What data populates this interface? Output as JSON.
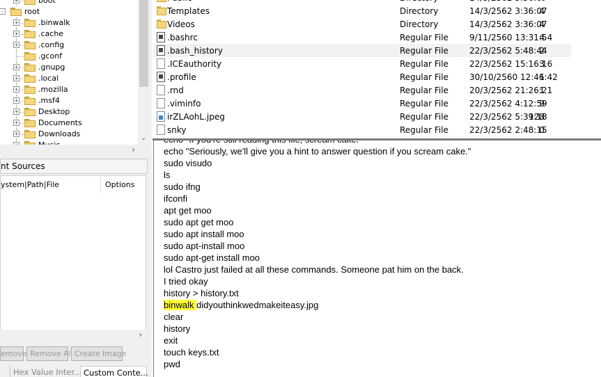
{
  "tree": {
    "items": [
      {
        "label": "boot",
        "indent": 1,
        "expander": "+"
      },
      {
        "label": "root",
        "indent": 0,
        "expander": "−"
      },
      {
        "label": ".binwalk",
        "indent": 1,
        "expander": "+"
      },
      {
        "label": ".cache",
        "indent": 1,
        "expander": "+"
      },
      {
        "label": ".config",
        "indent": 1,
        "expander": "+"
      },
      {
        "label": ".gconf",
        "indent": 1,
        "expander": ""
      },
      {
        "label": ".gnupg",
        "indent": 1,
        "expander": "+"
      },
      {
        "label": ".local",
        "indent": 1,
        "expander": "+"
      },
      {
        "label": ".mozilla",
        "indent": 1,
        "expander": "+"
      },
      {
        "label": ".msf4",
        "indent": 1,
        "expander": "+"
      },
      {
        "label": "Desktop",
        "indent": 1,
        "expander": "+"
      },
      {
        "label": "Documents",
        "indent": 1,
        "expander": "+"
      },
      {
        "label": "Downloads",
        "indent": 1,
        "expander": "+"
      },
      {
        "label": "Music",
        "indent": 1,
        "expander": "+"
      }
    ]
  },
  "evidence": {
    "header": "nt Sources",
    "columns": [
      "ystem|Path|File",
      "Options"
    ]
  },
  "buttons": {
    "remove": "emove",
    "remove_all": "Remove All",
    "create_image": "Create Image"
  },
  "bottom_tabs": {
    "hex": "Hex Value Inter...",
    "custom": "Custom Conte..."
  },
  "files": [
    {
      "name": "Public",
      "size": "4",
      "type": "Directory",
      "date": "14/3/2562 3:36:07",
      "icon": "folder"
    },
    {
      "name": "Templates",
      "size": "4",
      "type": "Directory",
      "date": "14/3/2562 3:36:07",
      "icon": "folder"
    },
    {
      "name": "Videos",
      "size": "4",
      "type": "Directory",
      "date": "14/3/2562 3:36:07",
      "icon": "folder"
    },
    {
      "name": ".bashrc",
      "size": "4",
      "type": "Regular File",
      "date": "9/11/2560 13:31:54",
      "icon": "binary"
    },
    {
      "name": ".bash_history",
      "size": "2",
      "type": "Regular File",
      "date": "22/3/2562 5:48:44",
      "icon": "binary",
      "selected": true
    },
    {
      "name": ".ICEauthority",
      "size": "3",
      "type": "Regular File",
      "date": "22/3/2562 15:16:16",
      "icon": "document"
    },
    {
      "name": ".profile",
      "size": "1",
      "type": "Regular File",
      "date": "30/10/2560 12:46:42",
      "icon": "binary"
    },
    {
      "name": ".rnd",
      "size": "1",
      "type": "Regular File",
      "date": "20/3/2562 21:26:21",
      "icon": "document"
    },
    {
      "name": ".viminfo",
      "size": "9",
      "type": "Regular File",
      "date": "22/3/2562 4:12:59",
      "icon": "document"
    },
    {
      "name": "irZLAohL.jpeg",
      "size": "128",
      "type": "Regular File",
      "date": "22/3/2562 5:39:18",
      "icon": "image"
    },
    {
      "name": "snky",
      "size": "0",
      "type": "Regular File",
      "date": "22/3/2562 2:48:15",
      "icon": "document"
    }
  ],
  "text_lines": [
    {
      "pre": "echo \"If you're still reading this file, scream cake.\"",
      "hl": "",
      "post": ""
    },
    {
      "pre": "echo \"Seriously, we'll give you a hint to answer question if you scream cake.\"",
      "hl": "",
      "post": ""
    },
    {
      "pre": "sudo visudo",
      "hl": "",
      "post": ""
    },
    {
      "pre": "ls",
      "hl": "",
      "post": ""
    },
    {
      "pre": "sudo ifng",
      "hl": "",
      "post": ""
    },
    {
      "pre": "ifconfi",
      "hl": "",
      "post": ""
    },
    {
      "pre": "apt get moo",
      "hl": "",
      "post": ""
    },
    {
      "pre": "sudo apt get moo",
      "hl": "",
      "post": ""
    },
    {
      "pre": "sudo apt install moo",
      "hl": "",
      "post": ""
    },
    {
      "pre": "sudo apt-install moo",
      "hl": "",
      "post": ""
    },
    {
      "pre": "sudo apt-get install moo",
      "hl": "",
      "post": ""
    },
    {
      "pre": "lol Castro just failed at all these commands. Someone pat him on the back.",
      "hl": "",
      "post": ""
    },
    {
      "pre": "I tried okay",
      "hl": "",
      "post": ""
    },
    {
      "pre": "history > history.txt",
      "hl": "",
      "post": ""
    },
    {
      "pre": "",
      "hl": "binwalk ",
      "post": "didyouthinkwedmakeiteasy.jpg"
    },
    {
      "pre": "clear",
      "hl": "",
      "post": ""
    },
    {
      "pre": "history",
      "hl": "",
      "post": ""
    },
    {
      "pre": "exit",
      "hl": "",
      "post": ""
    },
    {
      "pre": "touch keys.txt",
      "hl": "",
      "post": ""
    },
    {
      "pre": "pwd",
      "hl": "",
      "post": ""
    }
  ],
  "colors": {
    "highlight": "#ffff33",
    "selection": "#f2f2f2",
    "folder": "#f5d67a"
  }
}
